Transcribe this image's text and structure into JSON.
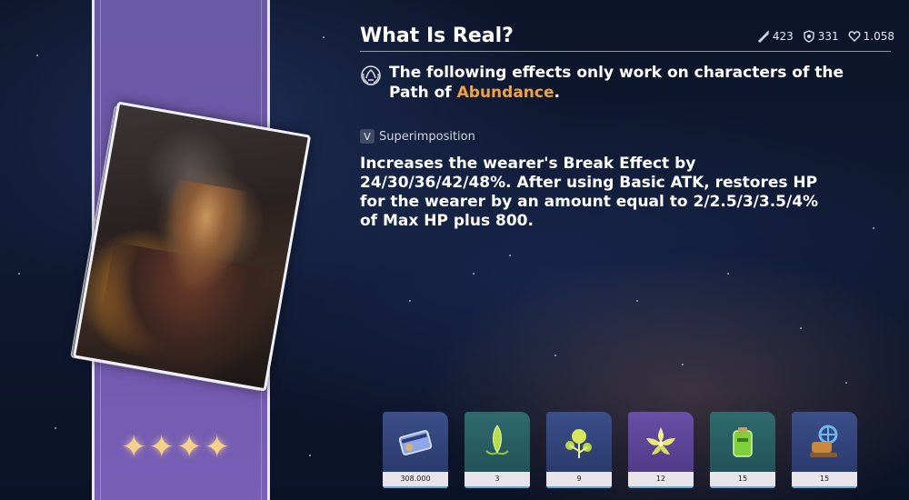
{
  "lightcone": {
    "title": "What Is Real?",
    "rarity_stars": 4,
    "stats": [
      {
        "icon": "atk-icon",
        "value": "423"
      },
      {
        "icon": "def-icon",
        "value": "331"
      },
      {
        "icon": "hp-icon",
        "value": "1.058"
      }
    ],
    "path_notice_before": "The following effects only work on characters of the Path of",
    "path_name": "Abundance",
    "path_notice_after": ".",
    "superimposition": {
      "badge": "V",
      "label": "Superimposition"
    },
    "description_line1": "Increases the wearer's Break Effect by",
    "description_line2": "24/30/36/42/48%. After using Basic ATK, restores HP",
    "description_line3": "for the wearer by an amount equal to 2/2.5/3/3.5/4%",
    "description_line4": "of Max HP plus 800."
  },
  "materials": [
    {
      "icon": "credit-card-icon",
      "quantity": "308.000",
      "rarity": "blue"
    },
    {
      "icon": "green-seed-icon",
      "quantity": "3",
      "rarity": "green"
    },
    {
      "icon": "blooming-sprout-icon",
      "quantity": "9",
      "rarity": "blue"
    },
    {
      "icon": "lotus-flower-icon",
      "quantity": "12",
      "rarity": "purple"
    },
    {
      "icon": "battery-icon",
      "quantity": "15",
      "rarity": "green"
    },
    {
      "icon": "valve-gear-icon",
      "quantity": "15",
      "rarity": "blue"
    }
  ],
  "colors": {
    "accent": "#f1a244",
    "banner": "#6f56a8",
    "stars": "#f5d08a"
  }
}
